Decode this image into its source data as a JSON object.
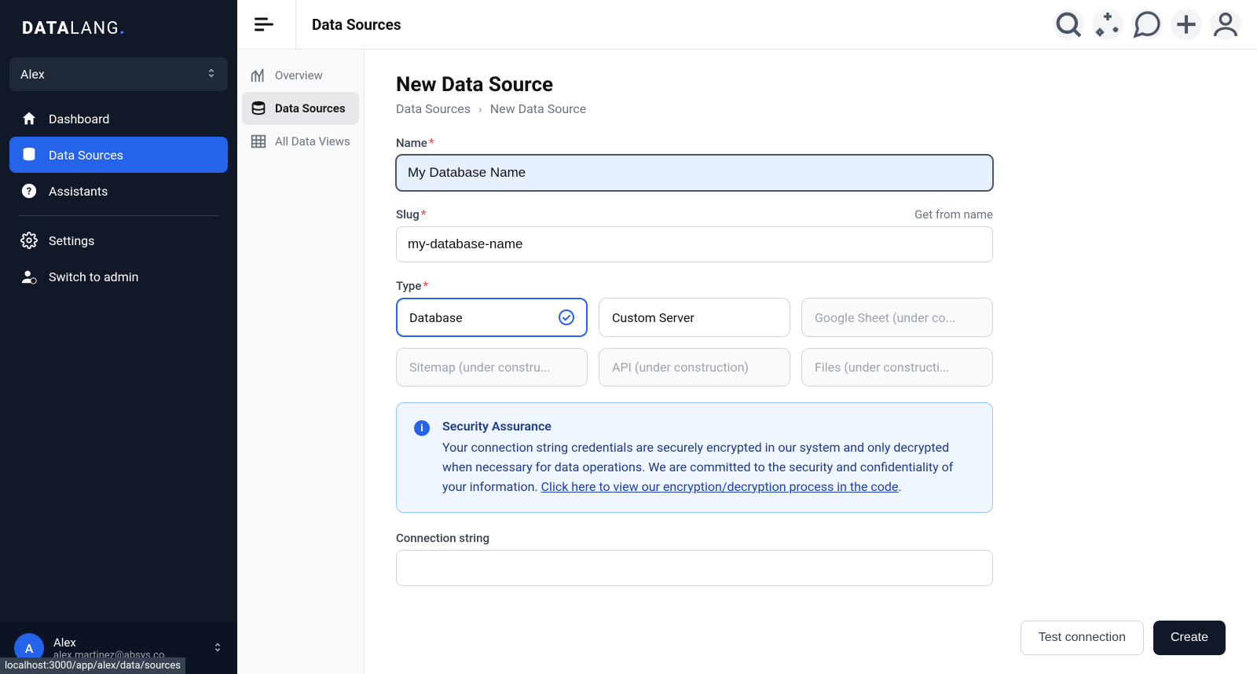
{
  "brand": {
    "part1": "DATA",
    "part2": "LANG",
    "dot": "."
  },
  "workspace": {
    "name": "Alex"
  },
  "nav": {
    "dashboard": "Dashboard",
    "data_sources": "Data Sources",
    "assistants": "Assistants",
    "settings": "Settings",
    "switch_admin": "Switch to admin"
  },
  "sidebar_footer": {
    "avatar_letter": "A",
    "name": "Alex",
    "email": "alex.martinez@absys.co..."
  },
  "topbar": {
    "title": "Data Sources"
  },
  "subnav": {
    "overview": "Overview",
    "data_sources": "Data Sources",
    "all_data_views": "All Data Views"
  },
  "page": {
    "title": "New Data Source",
    "breadcrumb_root": "Data Sources",
    "breadcrumb_sep": "›",
    "breadcrumb_current": "New Data Source"
  },
  "form": {
    "name_label": "Name",
    "name_value": "My Database Name",
    "slug_label": "Slug",
    "slug_hint": "Get from name",
    "slug_value": "my-database-name",
    "type_label": "Type",
    "types": {
      "database": "Database",
      "custom_server": "Custom Server",
      "google_sheet": "Google Sheet (under co...",
      "sitemap": "Sitemap (under constru...",
      "api": "API (under construction)",
      "files": "Files (under constructi..."
    },
    "info": {
      "title": "Security Assurance",
      "body_pre": "Your connection string credentials are securely encrypted in our system and only decrypted when necessary for data operations. We are committed to the security and confidentiality of your information. ",
      "link": "Click here to view our encryption/decryption process in the code",
      "body_post": "."
    },
    "connection_label": "Connection string",
    "connection_value": ""
  },
  "actions": {
    "test_connection": "Test connection",
    "create": "Create"
  },
  "status_url": "localhost:3000/app/alex/data/sources"
}
